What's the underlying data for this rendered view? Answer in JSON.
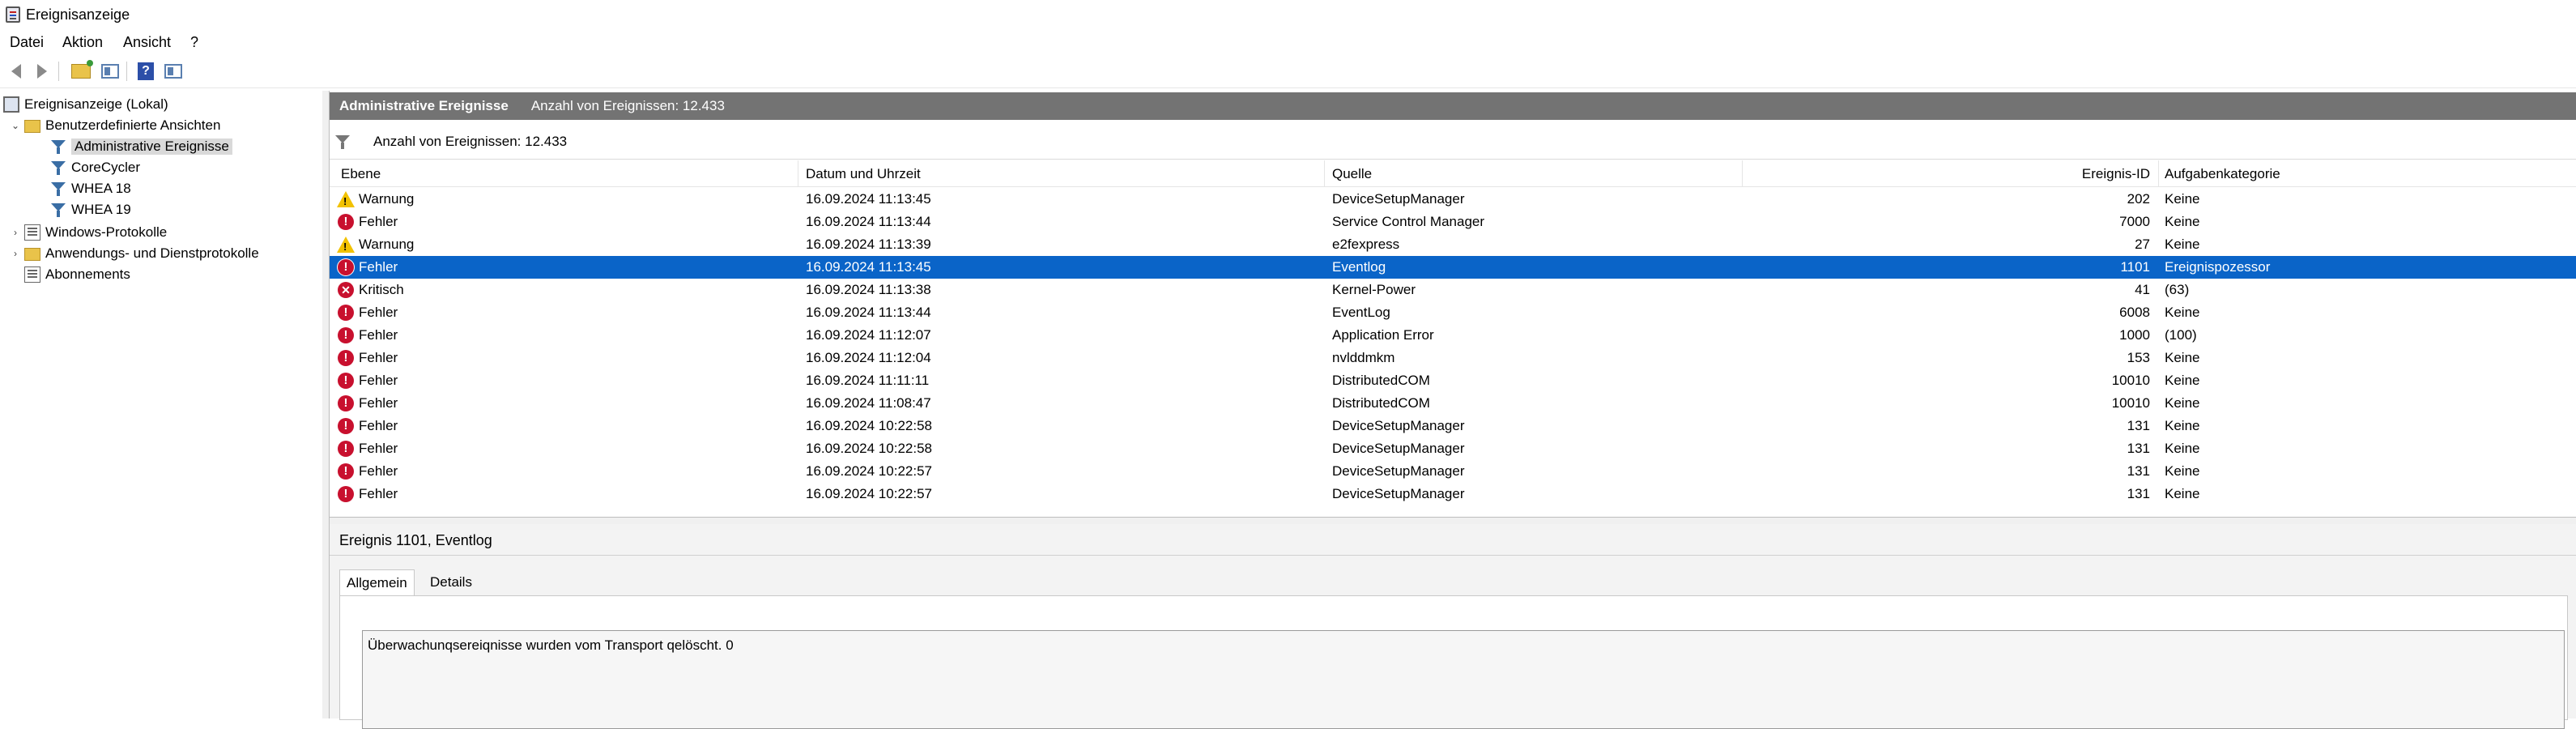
{
  "window": {
    "title": "Ereignisanzeige"
  },
  "menu": {
    "items": [
      "Datei",
      "Aktion",
      "Ansicht",
      "?"
    ]
  },
  "tree": {
    "items": [
      {
        "label": "Ereignisanzeige (Lokal)",
        "icon": "computer-icon"
      },
      {
        "label": "Benutzerdefinierte Ansichten",
        "icon": "folder-icon",
        "expanded": true
      },
      {
        "label": "Administrative Ereignisse",
        "icon": "filter-icon",
        "selected": true
      },
      {
        "label": "CoreCycler",
        "icon": "filter-icon"
      },
      {
        "label": "WHEA 18",
        "icon": "filter-icon"
      },
      {
        "label": "WHEA 19",
        "icon": "filter-icon"
      },
      {
        "label": "Windows-Protokolle",
        "icon": "log-folder-icon",
        "expanded": false
      },
      {
        "label": "Anwendungs- und Dienstprotokolle",
        "icon": "folder-icon",
        "expanded": false
      },
      {
        "label": "Abonnements",
        "icon": "log-icon"
      }
    ]
  },
  "header": {
    "title": "Administrative Ereignisse",
    "count": "Anzahl von Ereignissen: 12.433"
  },
  "filter": {
    "text": "Anzahl von Ereignissen: 12.433"
  },
  "table": {
    "columns": [
      "Ebene",
      "Datum und Uhrzeit",
      "Quelle",
      "Ereignis-ID",
      "Aufgabenkategorie"
    ],
    "rows": [
      {
        "level": "Warnung",
        "type": "warning",
        "date": "16.09.2024 11:13:45",
        "source": "DeviceSetupManager",
        "id": "202",
        "task": "Keine"
      },
      {
        "level": "Fehler",
        "type": "error",
        "date": "16.09.2024 11:13:44",
        "source": "Service Control Manager",
        "id": "7000",
        "task": "Keine"
      },
      {
        "level": "Warnung",
        "type": "warning",
        "date": "16.09.2024 11:13:39",
        "source": "e2fexpress",
        "id": "27",
        "task": "Keine"
      },
      {
        "level": "Fehler",
        "type": "error",
        "date": "16.09.2024 11:13:45",
        "source": "Eventlog",
        "id": "1101",
        "task": "Ereignispozessor",
        "selected": true
      },
      {
        "level": "Kritisch",
        "type": "critical",
        "date": "16.09.2024 11:13:38",
        "source": "Kernel-Power",
        "id": "41",
        "task": "(63)"
      },
      {
        "level": "Fehler",
        "type": "error",
        "date": "16.09.2024 11:13:44",
        "source": "EventLog",
        "id": "6008",
        "task": "Keine"
      },
      {
        "level": "Fehler",
        "type": "error",
        "date": "16.09.2024 11:12:07",
        "source": "Application Error",
        "id": "1000",
        "task": "(100)"
      },
      {
        "level": "Fehler",
        "type": "error",
        "date": "16.09.2024 11:12:04",
        "source": "nvlddmkm",
        "id": "153",
        "task": "Keine"
      },
      {
        "level": "Fehler",
        "type": "error",
        "date": "16.09.2024 11:11:11",
        "source": "DistributedCOM",
        "id": "10010",
        "task": "Keine"
      },
      {
        "level": "Fehler",
        "type": "error",
        "date": "16.09.2024 11:08:47",
        "source": "DistributedCOM",
        "id": "10010",
        "task": "Keine"
      },
      {
        "level": "Fehler",
        "type": "error",
        "date": "16.09.2024 10:22:58",
        "source": "DeviceSetupManager",
        "id": "131",
        "task": "Keine"
      },
      {
        "level": "Fehler",
        "type": "error",
        "date": "16.09.2024 10:22:58",
        "source": "DeviceSetupManager",
        "id": "131",
        "task": "Keine"
      },
      {
        "level": "Fehler",
        "type": "error",
        "date": "16.09.2024 10:22:57",
        "source": "DeviceSetupManager",
        "id": "131",
        "task": "Keine"
      },
      {
        "level": "Fehler",
        "type": "error",
        "date": "16.09.2024 10:22:57",
        "source": "DeviceSetupManager",
        "id": "131",
        "task": "Keine"
      }
    ]
  },
  "details": {
    "title": "Ereignis 1101, Eventlog",
    "tabs": [
      "Allgemein",
      "Details"
    ],
    "message": "Überwachunqsereiqnisse wurden vom Transport qelöscht. 0"
  },
  "colors": {
    "selection": "#0a64c8",
    "header_bar": "#737373",
    "error": "#c8102e",
    "warning": "#f2c200"
  }
}
